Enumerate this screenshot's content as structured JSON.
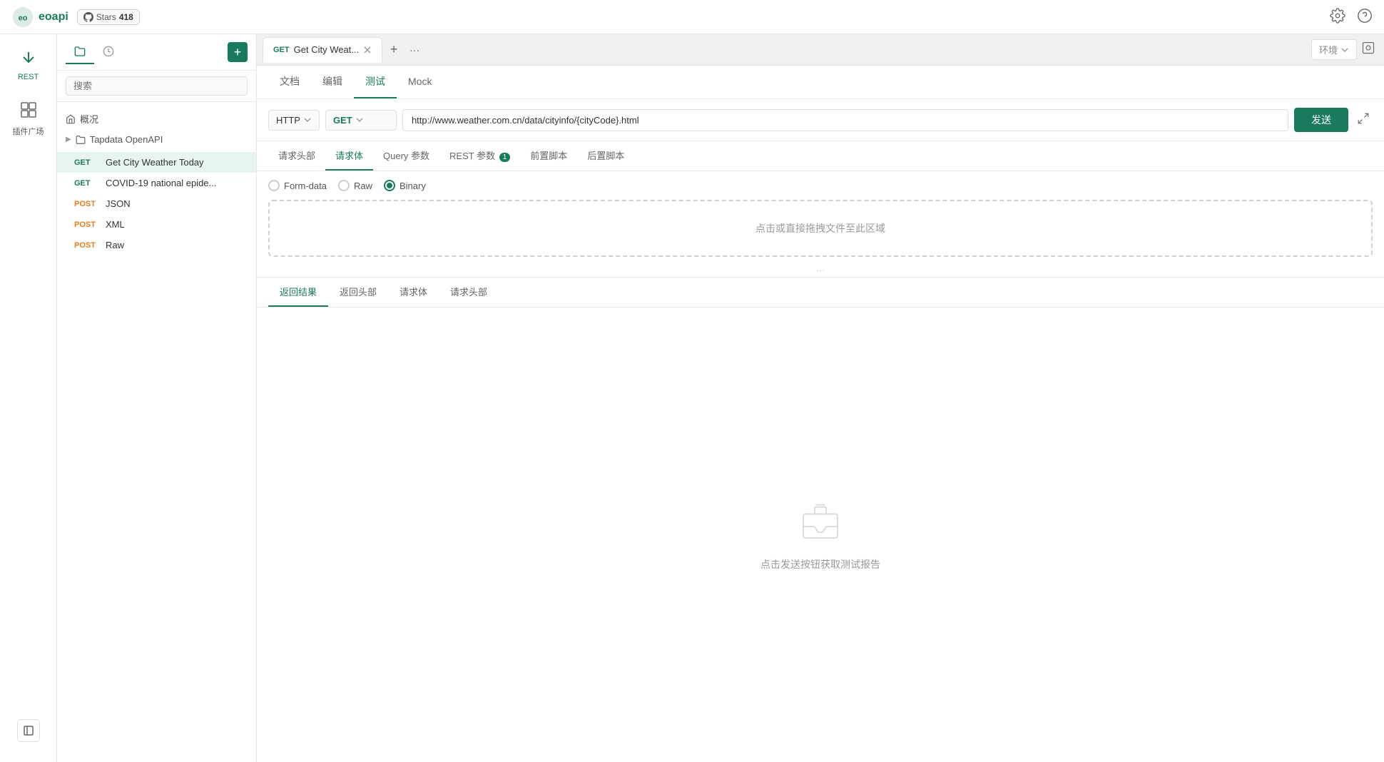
{
  "app": {
    "title": "eoapi",
    "logo_text": "eoapi"
  },
  "github": {
    "stars_label": "Stars",
    "count": "418"
  },
  "sidebar_icons": [
    {
      "id": "rest",
      "label": "REST",
      "icon": "↑↓",
      "active": true
    },
    {
      "id": "plugins",
      "label": "插件广场",
      "icon": "🧩",
      "active": false
    }
  ],
  "file_tree": {
    "search_placeholder": "搜索",
    "tabs": [
      {
        "id": "files",
        "label": "📁",
        "active": true
      },
      {
        "id": "history",
        "label": "🕐",
        "active": false
      }
    ],
    "home_label": "概况",
    "sections": [
      {
        "id": "tapdata",
        "label": "Tapdata OpenAPI",
        "expanded": false,
        "items": [
          {
            "method": "GET",
            "name": "Get City Weather Today",
            "active": true
          },
          {
            "method": "GET",
            "name": "COVID-19 national epide...",
            "active": false
          },
          {
            "method": "POST",
            "name": "JSON",
            "active": false
          },
          {
            "method": "POST",
            "name": "XML",
            "active": false
          },
          {
            "method": "POST",
            "name": "Raw",
            "active": false
          }
        ]
      }
    ]
  },
  "tabs": [
    {
      "id": "weather",
      "method": "GET",
      "label": "Get City Weat...",
      "active": true
    }
  ],
  "tab_actions": {
    "add_label": "+",
    "more_label": "···"
  },
  "env_selector": {
    "label": "环境",
    "placeholder": "环境"
  },
  "request": {
    "tabs": [
      {
        "id": "docs",
        "label": "文档",
        "active": false
      },
      {
        "id": "edit",
        "label": "编辑",
        "active": false
      },
      {
        "id": "test",
        "label": "测试",
        "active": true
      },
      {
        "id": "mock",
        "label": "Mock",
        "active": false
      }
    ],
    "protocol": "HTTP",
    "method": "GET",
    "url": "http://www.weather.com.cn/data/cityinfo/{cityCode}.html",
    "send_label": "发送",
    "body_tabs": [
      {
        "id": "request-headers",
        "label": "请求头部",
        "active": false
      },
      {
        "id": "request-body",
        "label": "请求体",
        "active": true
      },
      {
        "id": "query-params",
        "label": "Query 参数",
        "active": false
      },
      {
        "id": "rest-params",
        "label": "REST 参数",
        "active": false,
        "badge": "1"
      },
      {
        "id": "pre-script",
        "label": "前置脚本",
        "active": false
      },
      {
        "id": "post-script",
        "label": "后置脚本",
        "active": false
      }
    ],
    "body_types": [
      {
        "id": "form-data",
        "label": "Form-data",
        "checked": false
      },
      {
        "id": "raw",
        "label": "Raw",
        "checked": false
      },
      {
        "id": "binary",
        "label": "Binary",
        "checked": true
      }
    ],
    "drop_zone_text": "点击或直接拖拽文件至此区域"
  },
  "response": {
    "tabs": [
      {
        "id": "return-result",
        "label": "返回结果",
        "active": true
      },
      {
        "id": "return-headers",
        "label": "返回头部",
        "active": false
      },
      {
        "id": "request-body",
        "label": "请求体",
        "active": false
      },
      {
        "id": "request-headers",
        "label": "请求头部",
        "active": false
      }
    ],
    "empty_text": "点击发送按钮获取测试报告"
  },
  "colors": {
    "primary": "#1a7a5e",
    "get_method": "#1a7a5e",
    "post_method": "#e67e22"
  }
}
